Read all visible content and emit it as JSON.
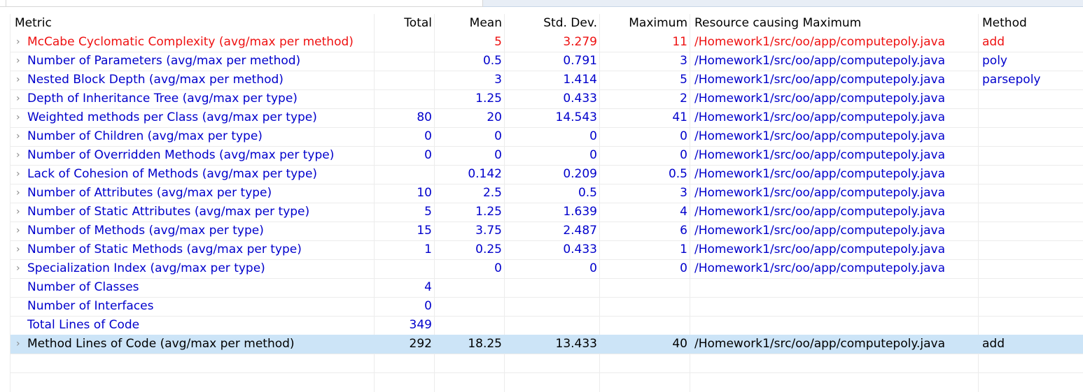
{
  "columns": {
    "metric": "Metric",
    "total": "Total",
    "mean": "Mean",
    "std_dev": "Std. Dev.",
    "maximum": "Maximum",
    "resource": "Resource causing Maximum",
    "method": "Method"
  },
  "rows": [
    {
      "metric": "McCabe Cyclomatic Complexity (avg/max per method)",
      "total": "",
      "mean": "5",
      "std_dev": "3.279",
      "maximum": "11",
      "resource": "/Homework1/src/oo/app/computepoly.java",
      "method": "add",
      "expandable": true,
      "status": "warning"
    },
    {
      "metric": "Number of Parameters (avg/max per method)",
      "total": "",
      "mean": "0.5",
      "std_dev": "0.791",
      "maximum": "3",
      "resource": "/Homework1/src/oo/app/computepoly.java",
      "method": "poly",
      "expandable": true,
      "status": "normal"
    },
    {
      "metric": "Nested Block Depth (avg/max per method)",
      "total": "",
      "mean": "3",
      "std_dev": "1.414",
      "maximum": "5",
      "resource": "/Homework1/src/oo/app/computepoly.java",
      "method": "parsepoly",
      "expandable": true,
      "status": "normal"
    },
    {
      "metric": "Depth of Inheritance Tree (avg/max per type)",
      "total": "",
      "mean": "1.25",
      "std_dev": "0.433",
      "maximum": "2",
      "resource": "/Homework1/src/oo/app/computepoly.java",
      "method": "",
      "expandable": true,
      "status": "normal"
    },
    {
      "metric": "Weighted methods per Class (avg/max per type)",
      "total": "80",
      "mean": "20",
      "std_dev": "14.543",
      "maximum": "41",
      "resource": "/Homework1/src/oo/app/computepoly.java",
      "method": "",
      "expandable": true,
      "status": "normal"
    },
    {
      "metric": "Number of Children (avg/max per type)",
      "total": "0",
      "mean": "0",
      "std_dev": "0",
      "maximum": "0",
      "resource": "/Homework1/src/oo/app/computepoly.java",
      "method": "",
      "expandable": true,
      "status": "normal"
    },
    {
      "metric": "Number of Overridden Methods (avg/max per type)",
      "total": "0",
      "mean": "0",
      "std_dev": "0",
      "maximum": "0",
      "resource": "/Homework1/src/oo/app/computepoly.java",
      "method": "",
      "expandable": true,
      "status": "normal"
    },
    {
      "metric": "Lack of Cohesion of Methods (avg/max per type)",
      "total": "",
      "mean": "0.142",
      "std_dev": "0.209",
      "maximum": "0.5",
      "resource": "/Homework1/src/oo/app/computepoly.java",
      "method": "",
      "expandable": true,
      "status": "normal"
    },
    {
      "metric": "Number of Attributes (avg/max per type)",
      "total": "10",
      "mean": "2.5",
      "std_dev": "0.5",
      "maximum": "3",
      "resource": "/Homework1/src/oo/app/computepoly.java",
      "method": "",
      "expandable": true,
      "status": "normal"
    },
    {
      "metric": "Number of Static Attributes (avg/max per type)",
      "total": "5",
      "mean": "1.25",
      "std_dev": "1.639",
      "maximum": "4",
      "resource": "/Homework1/src/oo/app/computepoly.java",
      "method": "",
      "expandable": true,
      "status": "normal"
    },
    {
      "metric": "Number of Methods (avg/max per type)",
      "total": "15",
      "mean": "3.75",
      "std_dev": "2.487",
      "maximum": "6",
      "resource": "/Homework1/src/oo/app/computepoly.java",
      "method": "",
      "expandable": true,
      "status": "normal"
    },
    {
      "metric": "Number of Static Methods (avg/max per type)",
      "total": "1",
      "mean": "0.25",
      "std_dev": "0.433",
      "maximum": "1",
      "resource": "/Homework1/src/oo/app/computepoly.java",
      "method": "",
      "expandable": true,
      "status": "normal"
    },
    {
      "metric": "Specialization Index (avg/max per type)",
      "total": "",
      "mean": "0",
      "std_dev": "0",
      "maximum": "0",
      "resource": "/Homework1/src/oo/app/computepoly.java",
      "method": "",
      "expandable": true,
      "status": "normal"
    },
    {
      "metric": "Number of Classes",
      "total": "4",
      "mean": "",
      "std_dev": "",
      "maximum": "",
      "resource": "",
      "method": "",
      "expandable": false,
      "status": "normal"
    },
    {
      "metric": "Number of Interfaces",
      "total": "0",
      "mean": "",
      "std_dev": "",
      "maximum": "",
      "resource": "",
      "method": "",
      "expandable": false,
      "status": "normal"
    },
    {
      "metric": "Total Lines of Code",
      "total": "349",
      "mean": "",
      "std_dev": "",
      "maximum": "",
      "resource": "",
      "method": "",
      "expandable": false,
      "status": "normal"
    },
    {
      "metric": "Method Lines of Code (avg/max per method)",
      "total": "292",
      "mean": "18.25",
      "std_dev": "13.433",
      "maximum": "40",
      "resource": "/Homework1/src/oo/app/computepoly.java",
      "method": "add",
      "expandable": true,
      "status": "selected"
    }
  ],
  "icons": {
    "expander": "chevron-right-icon"
  },
  "colors": {
    "metric_text": "#0000cc",
    "warning_text": "#ee1111",
    "selected_row_bg": "#cce4f7",
    "grid_line": "#ececec"
  }
}
